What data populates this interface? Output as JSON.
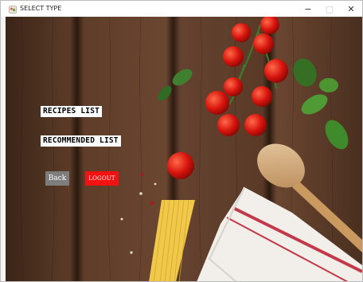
{
  "window": {
    "title": "SELECT TYPE",
    "controls": {
      "minimize": "−",
      "maximize": "□",
      "close": "✕"
    },
    "app_icon": "app-icon"
  },
  "menu": {
    "recipes_list_label": "RECIPES LIST",
    "recommended_list_label": "RECOMMENDED LIST"
  },
  "actions": {
    "back_label": "Back",
    "logout_label": "LOGOUT"
  },
  "colors": {
    "back_button": "#7d7d7d",
    "logout_button": "#f21212",
    "wood_background": "#5a3b28"
  }
}
